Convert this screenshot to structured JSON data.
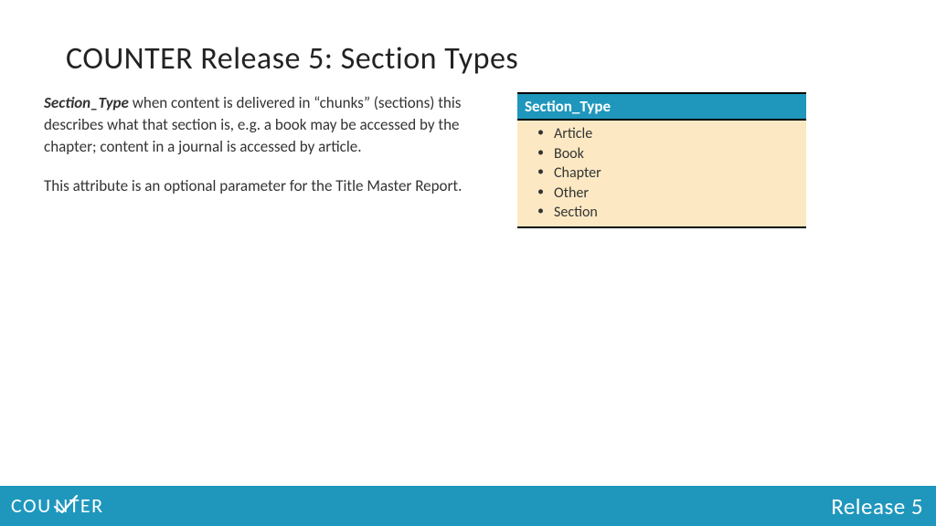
{
  "title": "COUNTER Release 5: Section Types",
  "description": {
    "term": "Section_Type",
    "para1_rest": " when content is delivered in “chunks” (sections) this describes what that section is, e.g. a book may be accessed by the chapter; content in a journal is accessed by article.",
    "para2": "This attribute is an optional parameter for the Title Master Report."
  },
  "table": {
    "header": "Section_Type",
    "items": [
      "Article",
      "Book",
      "Chapter",
      "Other",
      "Section"
    ]
  },
  "footer": {
    "logo_text": "COUNTER",
    "release": "Release 5"
  }
}
